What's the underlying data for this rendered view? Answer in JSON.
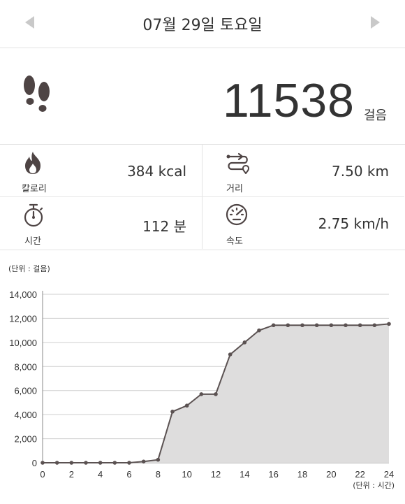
{
  "header": {
    "title": "07월 29일 토요일"
  },
  "steps": {
    "count": "11538",
    "unit": "걸음"
  },
  "stats": [
    {
      "label": "칼로리",
      "value": "384 kcal",
      "icon": "flame-icon"
    },
    {
      "label": "거리",
      "value": "7.50 km",
      "icon": "route-icon"
    },
    {
      "label": "시간",
      "value": "112 분",
      "icon": "stopwatch-icon"
    },
    {
      "label": "속도",
      "value": "2.75 km/h",
      "icon": "speedometer-icon"
    }
  ],
  "chart_unit_top": "(단위 : 걸음)",
  "chart_data": {
    "type": "area",
    "x": [
      0,
      1,
      2,
      3,
      4,
      5,
      6,
      7,
      8,
      9,
      10,
      11,
      12,
      13,
      14,
      15,
      16,
      17,
      18,
      19,
      20,
      21,
      22,
      23,
      24
    ],
    "values": [
      0,
      0,
      0,
      0,
      0,
      0,
      0,
      100,
      250,
      4250,
      4750,
      5700,
      5700,
      9000,
      10000,
      11000,
      11430,
      11430,
      11430,
      11430,
      11430,
      11430,
      11430,
      11430,
      11538
    ],
    "xlim": [
      0,
      24
    ],
    "ylim": [
      0,
      14000
    ],
    "xticks": [
      "0",
      "2",
      "4",
      "6",
      "8",
      "10",
      "12",
      "14",
      "16",
      "18",
      "20",
      "22",
      "24"
    ],
    "yticks": [
      "0",
      "2,000",
      "4,000",
      "6,000",
      "8,000",
      "10,000",
      "12,000",
      "14,000"
    ],
    "xunit": "(단위 : 시간)",
    "grid": true,
    "line_color": "#5b5252",
    "fill_color": "#dedddd"
  }
}
